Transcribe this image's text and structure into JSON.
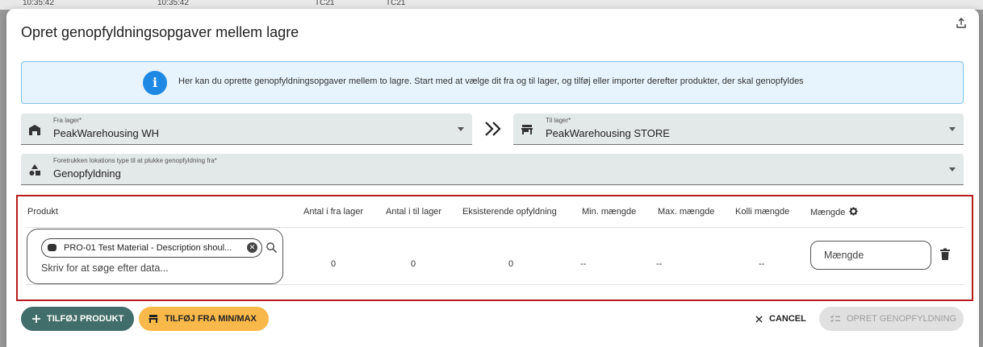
{
  "background": {
    "time_a": "10:35:42",
    "time_b": "10:35:42",
    "code_a": "TC21",
    "code_b": "TC21"
  },
  "dialog": {
    "title": "Opret genopfyldningsopgaver mellem lagre",
    "info_text": "Her kan du oprette genopfyldningsopgaver mellem to lagre. Start med at vælge dit fra og til lager, og tilføj eller importer derefter produkter, der skal genopfyldes"
  },
  "from_warehouse": {
    "label": "Fra lager*",
    "value": "PeakWarehousing WH"
  },
  "to_warehouse": {
    "label": "Til lager*",
    "value": "PeakWarehousing STORE"
  },
  "location_type": {
    "label": "Foretrukken lokations type til at plukke genopfyldning fra*",
    "value": "Genopfyldning"
  },
  "table": {
    "headers": {
      "product": "Produkt",
      "qty_from": "Antal i fra lager",
      "qty_to": "Antal i til lager",
      "existing": "Eksisterende opfyldning",
      "min": "Min. mængde",
      "max": "Max. mængde",
      "colli": "Kolli mængde",
      "quantity": "Mængde"
    },
    "row": {
      "product_chip": "PRO-01 Test Material - Description shoul...",
      "search_placeholder": "Skriv for at søge efter data...",
      "qty_from": "0",
      "qty_to": "0",
      "existing": "0",
      "min": "--",
      "max": "--",
      "colli": "--",
      "quantity_placeholder": "Mængde"
    }
  },
  "buttons": {
    "add_product": "TILFØJ PRODUKT",
    "add_minmax": "TILFØJ FRA MIN/MAX",
    "cancel": "CANCEL",
    "create": "OPRET GENOPFYLDNING"
  },
  "colors": {
    "primary": "#416e6a",
    "accent": "#f9b94a",
    "info": "#1e88e5",
    "highlight_border": "#b71c1c"
  },
  "icons": [
    "export-icon",
    "info-icon",
    "warehouse-icon",
    "store-icon",
    "double-chevron-right-icon",
    "shapes-icon",
    "gear-icon",
    "search-icon",
    "clear-icon",
    "trash-icon",
    "plus-icon",
    "truck-icon",
    "close-icon",
    "list-check-icon",
    "caret-down-icon"
  ]
}
